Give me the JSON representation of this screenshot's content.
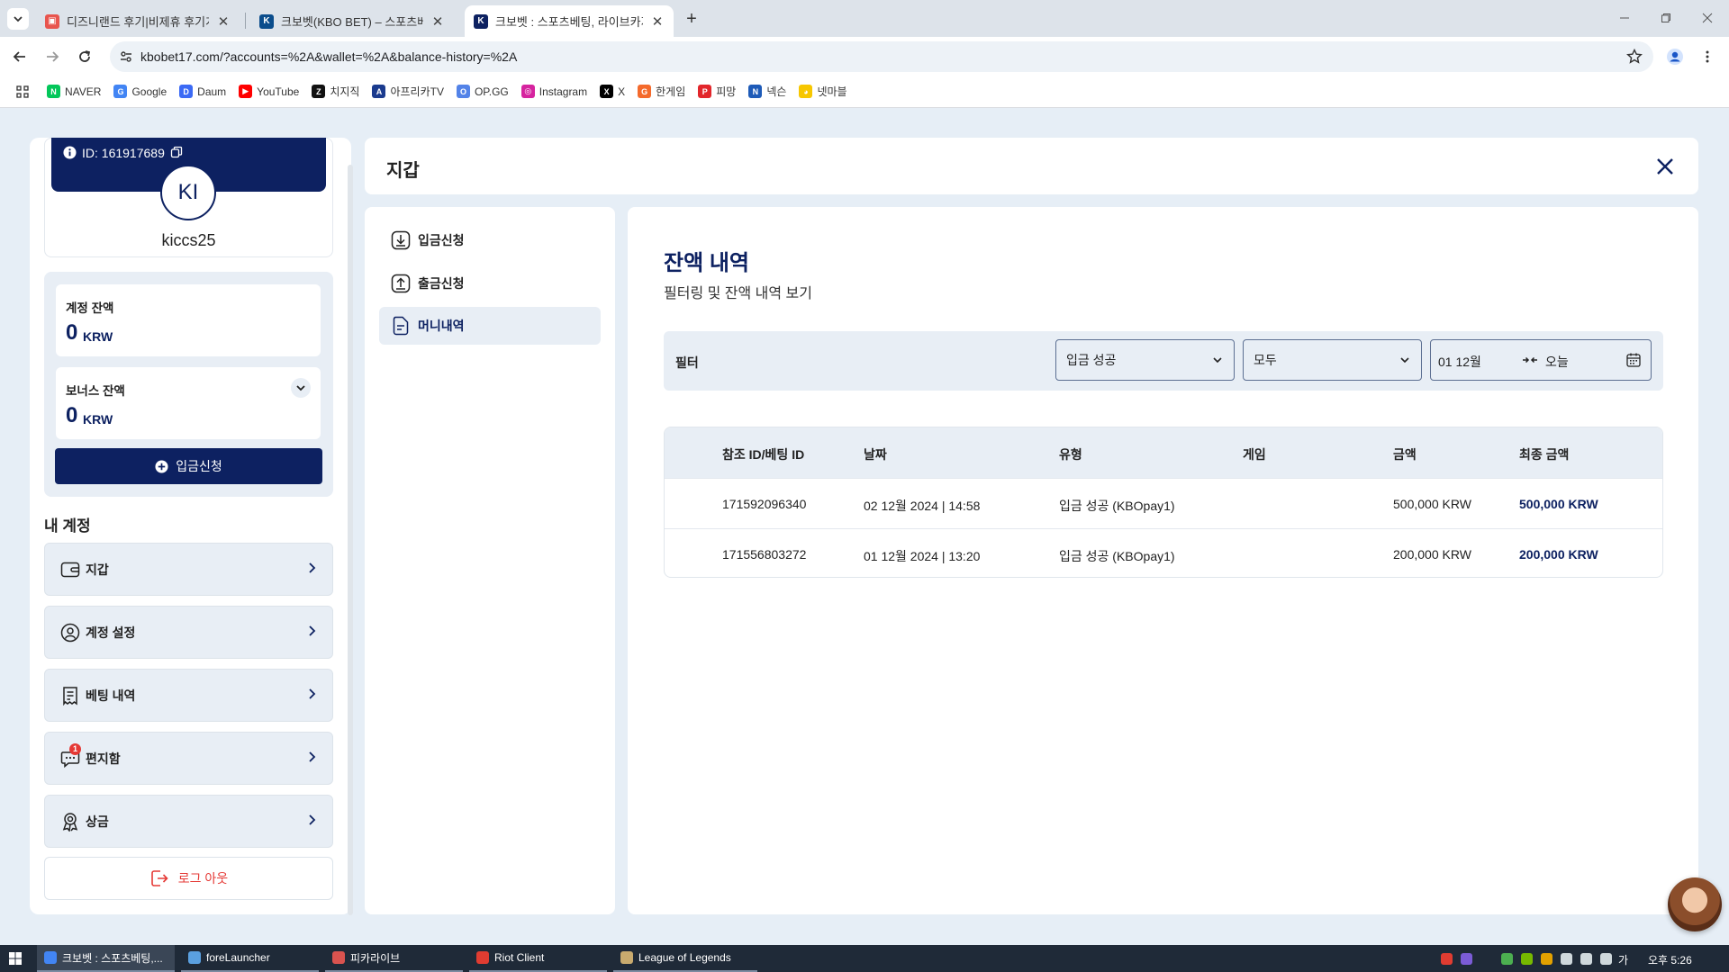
{
  "browser": {
    "tabs": [
      {
        "title": "디즈니랜드 후기|비제휴 후기게",
        "favicon_color": "#e8554e"
      },
      {
        "title": "크보벳(KBO BET) – 스포츠베팅",
        "favicon_color": "#0b4d8c"
      },
      {
        "title": "크보벳 : 스포츠베팅, 라이브카지",
        "favicon_color": "#0d2161"
      }
    ],
    "active_tab": 2,
    "url": "kbobet17.com/?accounts=%2A&wallet=%2A&balance-history=%2A",
    "bookmarks": [
      {
        "label": "NAVER",
        "icon": "N",
        "color": "#03c75a"
      },
      {
        "label": "Google",
        "icon": "G",
        "color": "#4285f4"
      },
      {
        "label": "Daum",
        "icon": "D",
        "color": "#3b6af5"
      },
      {
        "label": "YouTube",
        "icon": "▶",
        "color": "#ff0000"
      },
      {
        "label": "치지직",
        "icon": "Z",
        "color": "#111111"
      },
      {
        "label": "아프리카TV",
        "icon": "A",
        "color": "#1b3b8e"
      },
      {
        "label": "OP.GG",
        "icon": "O",
        "color": "#5383e8"
      },
      {
        "label": "Instagram",
        "icon": "◎",
        "color": "#d6249f"
      },
      {
        "label": "X",
        "icon": "X",
        "color": "#000000"
      },
      {
        "label": "한게임",
        "icon": "G",
        "color": "#f46a2c"
      },
      {
        "label": "피망",
        "icon": "P",
        "color": "#e2262b"
      },
      {
        "label": "넥슨",
        "icon": "N",
        "color": "#1e5bb8"
      },
      {
        "label": "넷마블",
        "icon": "◕",
        "color": "#f7c700"
      }
    ]
  },
  "profile": {
    "id_text": "ID: 161917689",
    "initials": "KI",
    "username": "kiccs25"
  },
  "balances": {
    "account_label": "계정 잔액",
    "account_amount": "0",
    "bonus_label": "보너스 잔액",
    "bonus_amount": "0",
    "currency": "KRW",
    "deposit_button": "입금신청"
  },
  "my_account": {
    "title": "내 계정",
    "items": [
      {
        "label": "지갑",
        "icon": "wallet-icon"
      },
      {
        "label": "계정 설정",
        "icon": "user-settings-icon"
      },
      {
        "label": "베팅 내역",
        "icon": "receipt-icon"
      },
      {
        "label": "편지함",
        "icon": "message-icon",
        "badge": "1"
      },
      {
        "label": "상금",
        "icon": "award-icon"
      }
    ],
    "logout": "로그 아웃"
  },
  "wallet": {
    "title": "지갑",
    "menu": [
      {
        "label": "입금신청",
        "icon": "download-icon"
      },
      {
        "label": "출금신청",
        "icon": "upload-icon"
      },
      {
        "label": "머니내역",
        "icon": "document-icon"
      }
    ],
    "active_menu": 2
  },
  "balance_history": {
    "title": "잔액 내역",
    "subtitle": "필터링 및 잔액 내역 보기",
    "filter": {
      "label": "필터",
      "type_select": "입금 성공",
      "scope_select": "모두",
      "date_from": "01 12월",
      "date_to": "오늘"
    },
    "columns": [
      "참조 ID/베팅 ID",
      "날짜",
      "유형",
      "게임",
      "금액",
      "최종 금액"
    ],
    "rows": [
      [
        "171592096340",
        "02 12월 2024 | 14:58",
        "입금 성공 (KBOpay1)",
        "",
        "500,000 KRW",
        "500,000 KRW"
      ],
      [
        "171556803272",
        "01 12월 2024 | 13:20",
        "입금 성공 (KBOpay1)",
        "",
        "200,000 KRW",
        "200,000 KRW"
      ]
    ]
  },
  "taskbar": {
    "tasks": [
      {
        "label": "크보벳 : 스포츠베팅,...",
        "color": "#4285f4"
      },
      {
        "label": "foreLauncher",
        "color": "#5aa0e0"
      },
      {
        "label": "피카라이브",
        "color": "#d9534f"
      },
      {
        "label": "Riot Client",
        "color": "#e03c31"
      },
      {
        "label": "League of Legends",
        "color": "#c8aa6e"
      }
    ],
    "ime": "가",
    "clock": "오후 5:26"
  },
  "colors": {
    "brand_navy": "#0d2161",
    "panel_bg": "#e8eef5",
    "logout_red": "#e53935"
  }
}
